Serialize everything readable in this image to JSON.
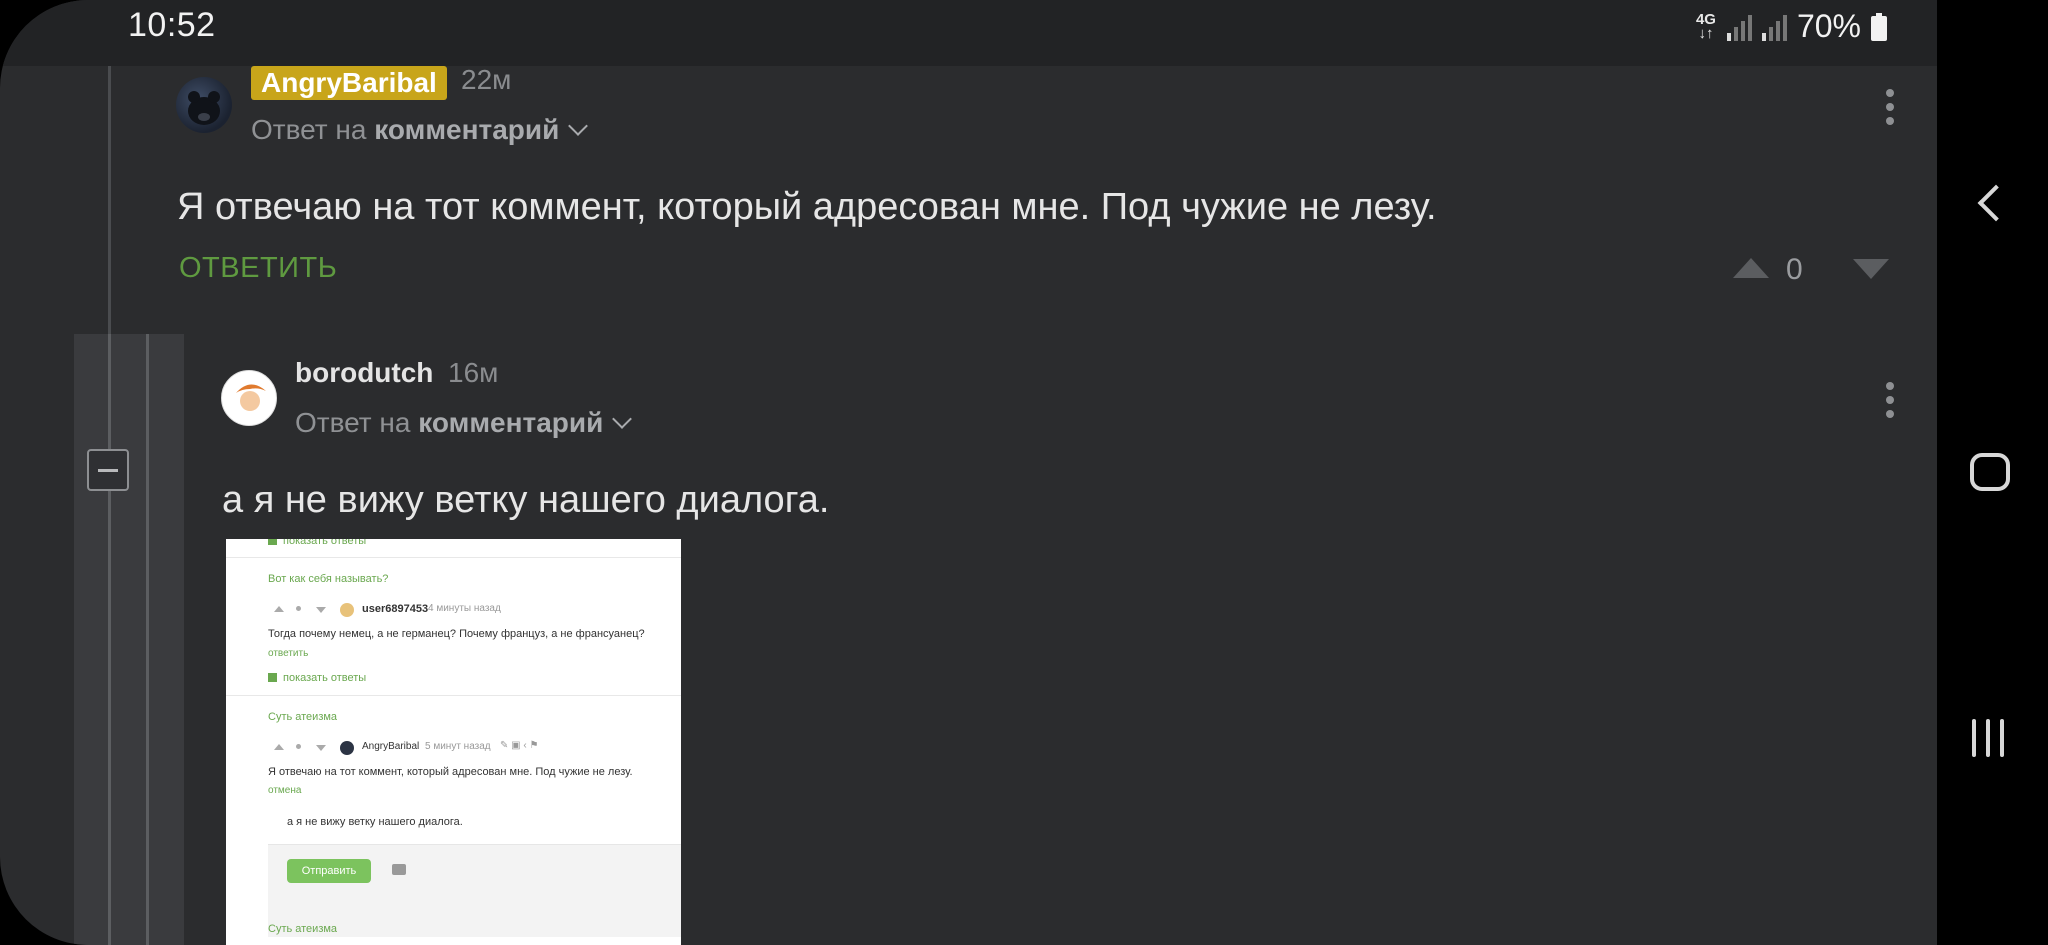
{
  "status_bar": {
    "time": "10:52",
    "network": "4G",
    "battery_percent": "70%"
  },
  "comments": [
    {
      "author": "AngryBaribal",
      "author_badge_color": "#c8a51a",
      "time_ago": "22м",
      "reply_prefix": "Ответ на",
      "reply_target": "комментарий",
      "text": "Я отвечаю на тот коммент, который адресован мне. Под чужие не лезу.",
      "reply_label": "ОТВЕТИТЬ",
      "rating": "0"
    },
    {
      "author": "borodutch",
      "time_ago": "16м",
      "reply_prefix": "Ответ на",
      "reply_target": "комментарий",
      "text": "а я не вижу ветку нашего диалога."
    }
  ],
  "embedded_screenshot": {
    "show_replies_1": "показать ответы",
    "title_1": "Вот как себя называть?",
    "user_1": "user6897453",
    "time_1": "4 минуты назад",
    "text_1": "Тогда почему немец, а не германец? Почему француз, а не франсуанец?",
    "reply_1": "ответить",
    "show_replies_2": "показать ответы",
    "title_2": "Суть атеизма",
    "user_2": "AngryBaribal",
    "time_2": "5 минут назад",
    "text_2": "Я отвечаю на тот коммент, который адресован мне. Под чужие не лезу.",
    "cancel": "отмена",
    "draft": "а я не вижу ветку нашего диалога.",
    "send": "Отправить",
    "title_3": "Суть атеизма"
  },
  "icons": {
    "reply_chevron": "chevron-down-icon",
    "more": "kebab-menu-icon",
    "upvote": "upvote-arrow-icon",
    "downvote": "downvote-arrow-icon",
    "collapse": "collapse-thread-icon",
    "back": "nav-back-icon",
    "home": "nav-home-icon",
    "recent": "nav-recent-apps-icon"
  },
  "colors": {
    "accent_green": "#5f9a40",
    "background": "#2b2c2e"
  }
}
